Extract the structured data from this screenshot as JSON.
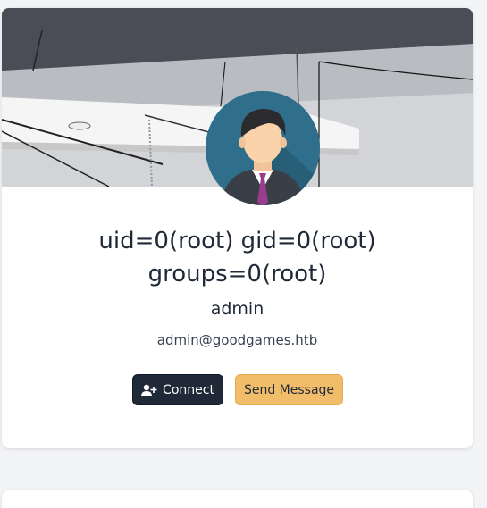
{
  "profile": {
    "title_line1": "uid=0(root) gid=0(root)",
    "title_line2": "groups=0(root)",
    "username": "admin",
    "email": "admin@goodgames.htb"
  },
  "actions": {
    "connect_label": "Connect",
    "message_label": "Send Message"
  },
  "icons": {
    "connect": "user-plus-icon",
    "avatar": "avatar-man-suit"
  },
  "colors": {
    "connect_bg": "#1f2937",
    "message_bg": "#f2bd6b",
    "avatar_bg": "#2f6f8c",
    "page_bg": "#f3f4f6"
  }
}
